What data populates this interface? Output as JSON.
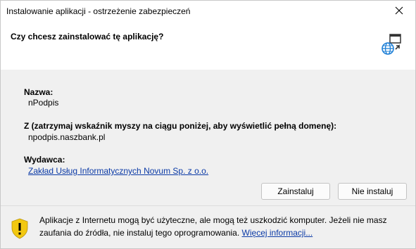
{
  "window": {
    "title": "Instalowanie aplikacji - ostrzeżenie zabezpieczeń"
  },
  "header": {
    "question": "Czy chcesz zainstalować tę aplikację?"
  },
  "details": {
    "name_label": "Nazwa:",
    "name_value": "nPodpis",
    "domain_label": "Z (zatrzymaj wskaźnik myszy na ciągu poniżej, aby wyświetlić pełną domenę):",
    "domain_value": "npodpis.naszbank.pl",
    "publisher_label": "Wydawca:",
    "publisher_value": "Zakład Usług Informatycznych Novum Sp. z o.o."
  },
  "buttons": {
    "install": "Zainstaluj",
    "cancel": "Nie instaluj"
  },
  "footer": {
    "warning_text": "Aplikacje z Internetu mogą być użyteczne, ale mogą też uszkodzić komputer. Jeżeli nie masz zaufania do źródła, nie instaluj tego oprogramowania.",
    "more_info_link": "Więcej informacji..."
  },
  "icons": {
    "close": "close-icon",
    "app": "app-install-globe-icon",
    "warning": "warning-shield-icon"
  },
  "colors": {
    "link": "#0b3aa6",
    "shield": "#f2c811",
    "globe": "#1e7fd6"
  }
}
